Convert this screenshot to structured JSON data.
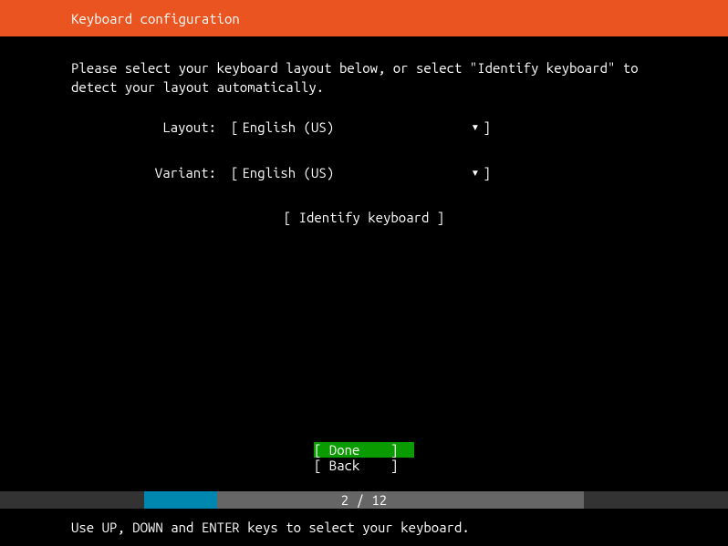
{
  "header": {
    "title": "Keyboard configuration"
  },
  "instruction": "Please select your keyboard layout below, or select \"Identify keyboard\" to detect your layout automatically.",
  "fields": {
    "layout": {
      "label": "Layout:",
      "value": "English (US)"
    },
    "variant": {
      "label": "Variant:",
      "value": "English (US)"
    }
  },
  "identify": {
    "label": "Identify keyboard"
  },
  "buttons": {
    "done": "Done",
    "back": "Back"
  },
  "progress": {
    "current": 2,
    "total": 12,
    "text": "2 / 12"
  },
  "help": "Use UP, DOWN and ENTER keys to select your keyboard."
}
